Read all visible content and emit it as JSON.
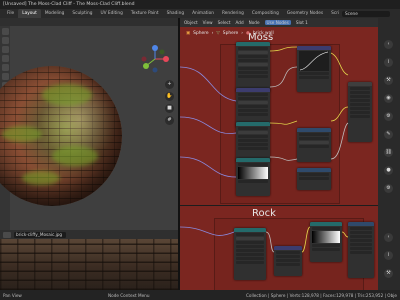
{
  "window": {
    "title": "[Unsaved] The Moss-Clad Cliff - The Moss-Clad Cliff.blend"
  },
  "menu": {
    "tabs": [
      "File",
      "Layout",
      "Modeling",
      "Sculpting",
      "UV Editing",
      "Texture Paint",
      "Shading",
      "Animation",
      "Rendering",
      "Compositing",
      "Geometry Nodes",
      "Scri"
    ],
    "active_tab": "Layout",
    "scene": "Scene"
  },
  "viewport": {
    "navigation_icons": [
      "zoom-icon",
      "hand-icon",
      "camera-icon",
      "grid-icon"
    ]
  },
  "image_editor": {
    "image_name": "brick-cliffy_Mosaic.jpg"
  },
  "node_editor": {
    "header_items": [
      "Object",
      "View",
      "Select",
      "Add",
      "Node",
      "Use Nodes",
      "Slot 1"
    ],
    "use_nodes_checked": true,
    "breadcrumb": [
      "Sphere",
      "Sphere",
      "brick wall"
    ],
    "frame_top_label": "Moss",
    "frame_bottom_label": "Rock"
  },
  "status": {
    "left": "Pan View",
    "middle": "Node Context Menu",
    "right": "Collection | Sphere | Verts:128,978 | Faces:129,978 | Tris:253,952 | Obje"
  },
  "colors": {
    "node_background": "#7b2620",
    "panel": "#2a2a2a",
    "accent": "#4772b3"
  }
}
